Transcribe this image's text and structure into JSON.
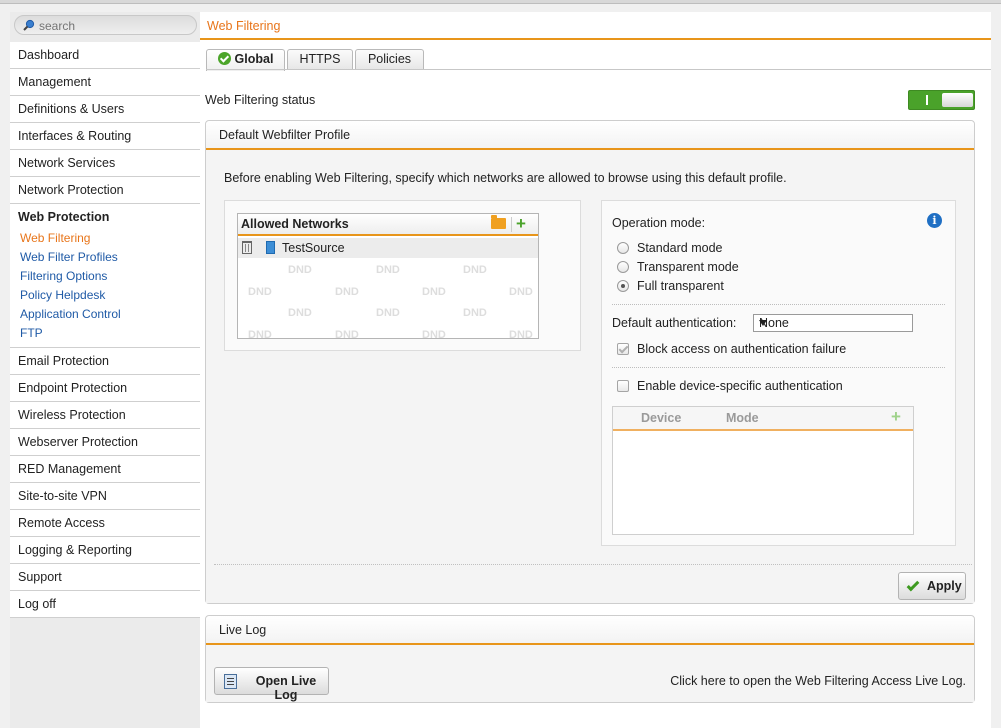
{
  "search": {
    "placeholder": "search",
    "icon": "search-icon"
  },
  "sidebar": {
    "items_top": [
      "Dashboard",
      "Management",
      "Definitions & Users",
      "Interfaces & Routing",
      "Network Services",
      "Network Protection"
    ],
    "group": {
      "label": "Web Protection",
      "subitems": [
        "Web Filtering",
        "Web Filter Profiles",
        "Filtering Options",
        "Policy Helpdesk",
        "Application Control",
        "FTP"
      ],
      "active_index": 0
    },
    "items_bottom": [
      "Email Protection",
      "Endpoint Protection",
      "Wireless Protection",
      "Webserver Protection",
      "RED Management",
      "Site-to-site VPN",
      "Remote Access",
      "Logging & Reporting",
      "Support",
      "Log off"
    ]
  },
  "page": {
    "title": "Web Filtering"
  },
  "tabs": [
    {
      "label": "Global",
      "active": true
    },
    {
      "label": "HTTPS",
      "active": false
    },
    {
      "label": "Policies",
      "active": false
    }
  ],
  "status": {
    "label": "Web Filtering status",
    "enabled": true
  },
  "profile_panel": {
    "title": "Default Webfilter Profile",
    "intro": "Before enabling Web Filtering, specify which networks are allowed to browse using this default profile.",
    "allowed_networks": {
      "title": "Allowed Networks",
      "items": [
        "TestSource"
      ],
      "dnd_label": "DND"
    },
    "operation_mode": {
      "label": "Operation mode:",
      "options": [
        "Standard mode",
        "Transparent mode",
        "Full transparent"
      ],
      "selected": 2
    },
    "default_auth": {
      "label": "Default authentication:",
      "value": "None"
    },
    "block_access": {
      "label": "Block access on authentication failure",
      "checked": true,
      "disabled": true
    },
    "device_auth": {
      "label": "Enable device-specific authentication",
      "checked": false
    },
    "device_table": {
      "columns": [
        "Device",
        "Mode"
      ]
    },
    "apply_label": "Apply"
  },
  "live_log": {
    "title": "Live Log",
    "button": "Open Live Log",
    "hint": "Click here to open the Web Filtering Access Live Log."
  },
  "colors": {
    "accent": "#e8751a",
    "link": "#1f5aa6",
    "toggle_on": "#4aa22a"
  }
}
